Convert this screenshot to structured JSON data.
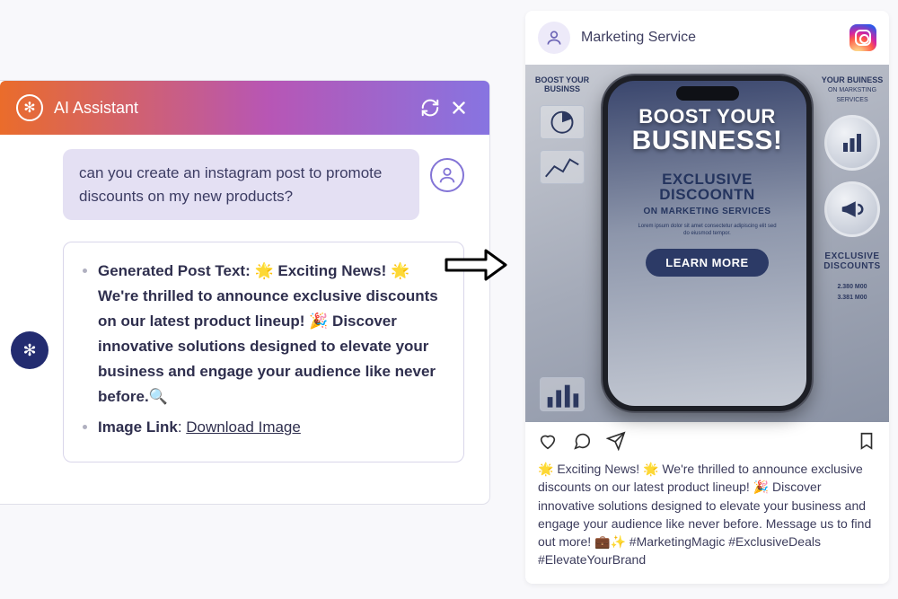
{
  "assistant": {
    "title": "AI Assistant",
    "header_icon": "✻",
    "ai_icon": "✻",
    "user_message": "can you create an instagram post to promote discounts on my new products?",
    "response": {
      "item1_label": "Generated Post Text",
      "item1_body": ": 🌟 Exciting News! 🌟We're thrilled to announce exclusive discounts on our latest product lineup! 🎉 Discover innovative solutions designed to elevate your business and engage your audience like never before.🔍",
      "item2_label": "Image Link",
      "item2_sep": ": ",
      "item2_link": "Download Image"
    }
  },
  "instagram": {
    "username": "Marketing Service",
    "image": {
      "left_title": "BOOST YOUR BUSINSS",
      "right_title": "YOUR BUINESS",
      "right_sub": "ON MARKSTING SERVICES",
      "phone_line1": "BOOST YOUR",
      "phone_line2": "BUSINESS!",
      "phone_h2": "EXCLUSIVE DISCOONTN",
      "phone_sub": "ON MARKETING SERVICES",
      "learn_btn": "LEARN MORE",
      "right_label": "EXCLUSIVE DISCOUNTS",
      "price1": "2.380  M00",
      "price2": "3.381  M00"
    },
    "caption": "🌟 Exciting News! 🌟 We're thrilled to announce exclusive discounts on our latest product lineup! 🎉 Discover innovative solutions designed to elevate your business and engage your audience like never before. Message us to find out more! 💼✨ #MarketingMagic #ExclusiveDeals #ElevateYourBrand"
  }
}
